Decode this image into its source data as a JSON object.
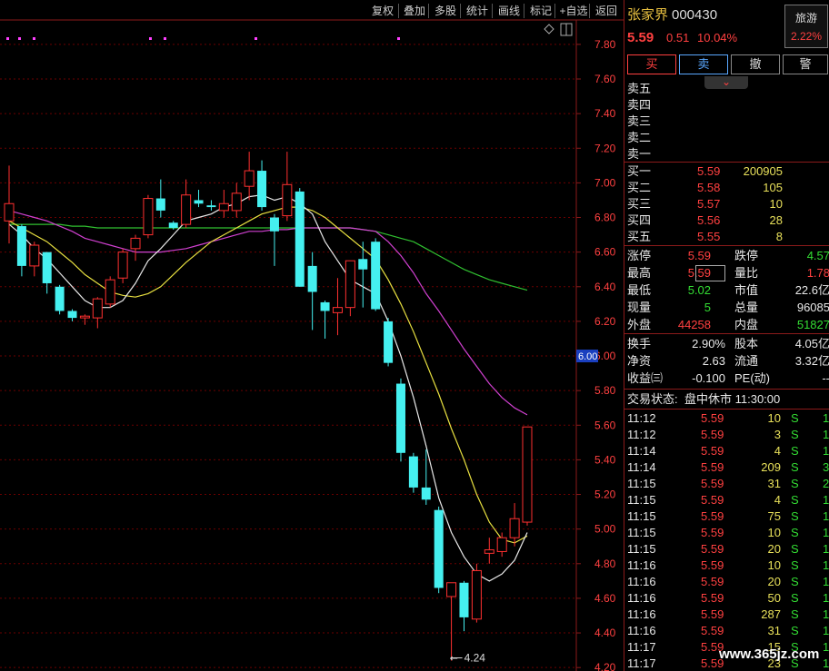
{
  "toolbar": {
    "items": [
      "复权",
      "叠加",
      "多股",
      "统计",
      "画线",
      "标记",
      "+自选",
      "返回"
    ]
  },
  "stock": {
    "name": "张家界",
    "code": "000430",
    "price": "5.59",
    "change": "0.51",
    "change_pct": "10.04%",
    "sector_name": "旅游",
    "sector_pct": "2.22%"
  },
  "actions": {
    "buy": "买",
    "sell": "卖",
    "cancel": "撤",
    "alert": "警"
  },
  "expand_arrow": "⌄",
  "asks": [
    {
      "label": "卖五",
      "price": "",
      "vol": ""
    },
    {
      "label": "卖四",
      "price": "",
      "vol": ""
    },
    {
      "label": "卖三",
      "price": "",
      "vol": ""
    },
    {
      "label": "卖二",
      "price": "",
      "vol": ""
    },
    {
      "label": "卖一",
      "price": "",
      "vol": ""
    }
  ],
  "bids": [
    {
      "label": "买一",
      "price": "5.59",
      "vol": "200905"
    },
    {
      "label": "买二",
      "price": "5.58",
      "vol": "105"
    },
    {
      "label": "买三",
      "price": "5.57",
      "vol": "10"
    },
    {
      "label": "买四",
      "price": "5.56",
      "vol": "28"
    },
    {
      "label": "买五",
      "price": "5.55",
      "vol": "8"
    }
  ],
  "stats": {
    "limit_up_label": "涨停",
    "limit_up": "5.59",
    "limit_down_label": "跌停",
    "limit_down": "4.57",
    "high_label": "最高",
    "high": "5.59",
    "vol_ratio_label": "量比",
    "vol_ratio": "1.78",
    "low_label": "最低",
    "low": "5.02",
    "mkt_cap_label": "市值",
    "mkt_cap": "22.6亿",
    "cur_vol_label": "现量",
    "cur_vol": "5",
    "total_vol_label": "总量",
    "total_vol": "96085",
    "outer_label": "外盘",
    "outer": "44258",
    "inner_label": "内盘",
    "inner": "51827",
    "turnover_label": "换手",
    "turnover": "2.90%",
    "shares_label": "股本",
    "shares": "4.05亿",
    "nav_label": "净资",
    "nav": "2.63",
    "float_label": "流通",
    "float": "3.32亿",
    "eps_label": "收益㈢",
    "eps": "-0.100",
    "pe_label": "PE(动)",
    "pe": "--"
  },
  "status": {
    "label": "交易状态:",
    "value": "盘中休市 11:30:00"
  },
  "trades": [
    {
      "time": "11:12",
      "price": "5.59",
      "vol": "10",
      "side": "S",
      "n": "1"
    },
    {
      "time": "11:12",
      "price": "5.59",
      "vol": "3",
      "side": "S",
      "n": "1"
    },
    {
      "time": "11:14",
      "price": "5.59",
      "vol": "4",
      "side": "S",
      "n": "1"
    },
    {
      "time": "11:14",
      "price": "5.59",
      "vol": "209",
      "side": "S",
      "n": "3"
    },
    {
      "time": "11:15",
      "price": "5.59",
      "vol": "31",
      "side": "S",
      "n": "2"
    },
    {
      "time": "11:15",
      "price": "5.59",
      "vol": "4",
      "side": "S",
      "n": "1"
    },
    {
      "time": "11:15",
      "price": "5.59",
      "vol": "75",
      "side": "S",
      "n": "1"
    },
    {
      "time": "11:15",
      "price": "5.59",
      "vol": "10",
      "side": "S",
      "n": "1"
    },
    {
      "time": "11:15",
      "price": "5.59",
      "vol": "20",
      "side": "S",
      "n": "1"
    },
    {
      "time": "11:16",
      "price": "5.59",
      "vol": "10",
      "side": "S",
      "n": "1"
    },
    {
      "time": "11:16",
      "price": "5.59",
      "vol": "20",
      "side": "S",
      "n": "1"
    },
    {
      "time": "11:16",
      "price": "5.59",
      "vol": "50",
      "side": "S",
      "n": "1"
    },
    {
      "time": "11:16",
      "price": "5.59",
      "vol": "287",
      "side": "S",
      "n": "1"
    },
    {
      "time": "11:16",
      "price": "5.59",
      "vol": "31",
      "side": "S",
      "n": "1"
    },
    {
      "time": "11:17",
      "price": "5.59",
      "vol": "15",
      "side": "S",
      "n": "1"
    },
    {
      "time": "11:17",
      "price": "5.59",
      "vol": "23",
      "side": "S",
      "n": "1"
    }
  ],
  "watermark": "www.365jz.com",
  "chart_data": {
    "type": "candlestick",
    "y_ticks": [
      "7.80",
      "7.60",
      "7.40",
      "7.20",
      "7.00",
      "6.80",
      "6.60",
      "6.40",
      "6.20",
      "6.00",
      "5.80",
      "5.60",
      "5.40",
      "5.20",
      "5.00",
      "4.80",
      "4.60",
      "4.40",
      "4.20"
    ],
    "ylim": [
      4.18,
      7.92
    ],
    "current_price_tag": "6.00",
    "low_marker": "4.24",
    "colors": {
      "up": "#ff3030",
      "down": "#45f0f0",
      "ma5": "#e8e8e8",
      "ma10": "#e8e040",
      "ma20": "#d040d0",
      "ma60": "#30c030",
      "grid": "#6b0000"
    },
    "candles": [
      {
        "o": 6.78,
        "h": 7.1,
        "l": 6.65,
        "c": 6.88
      },
      {
        "o": 6.75,
        "h": 6.76,
        "l": 6.46,
        "c": 6.52
      },
      {
        "o": 6.52,
        "h": 6.66,
        "l": 6.46,
        "c": 6.64
      },
      {
        "o": 6.6,
        "h": 6.6,
        "l": 6.36,
        "c": 6.42
      },
      {
        "o": 6.4,
        "h": 6.41,
        "l": 6.24,
        "c": 6.26
      },
      {
        "o": 6.26,
        "h": 6.27,
        "l": 6.2,
        "c": 6.22
      },
      {
        "o": 6.22,
        "h": 6.24,
        "l": 6.18,
        "c": 6.23
      },
      {
        "o": 6.22,
        "h": 6.34,
        "l": 6.16,
        "c": 6.33
      },
      {
        "o": 6.3,
        "h": 6.46,
        "l": 6.28,
        "c": 6.44
      },
      {
        "o": 6.45,
        "h": 6.62,
        "l": 6.42,
        "c": 6.6
      },
      {
        "o": 6.62,
        "h": 6.7,
        "l": 6.55,
        "c": 6.68
      },
      {
        "o": 6.7,
        "h": 6.93,
        "l": 6.68,
        "c": 6.91
      },
      {
        "o": 6.91,
        "h": 7.02,
        "l": 6.8,
        "c": 6.84
      },
      {
        "o": 6.77,
        "h": 6.78,
        "l": 6.73,
        "c": 6.74
      },
      {
        "o": 6.76,
        "h": 7.02,
        "l": 6.74,
        "c": 6.93
      },
      {
        "o": 6.9,
        "h": 6.96,
        "l": 6.86,
        "c": 6.88
      },
      {
        "o": 6.87,
        "h": 6.9,
        "l": 6.84,
        "c": 6.86
      },
      {
        "o": 6.84,
        "h": 6.96,
        "l": 6.8,
        "c": 6.88
      },
      {
        "o": 6.84,
        "h": 7.0,
        "l": 6.8,
        "c": 6.94
      },
      {
        "o": 6.98,
        "h": 7.18,
        "l": 6.9,
        "c": 7.07
      },
      {
        "o": 7.07,
        "h": 7.13,
        "l": 6.84,
        "c": 6.86
      },
      {
        "o": 6.8,
        "h": 6.82,
        "l": 6.52,
        "c": 6.72
      },
      {
        "o": 6.81,
        "h": 7.18,
        "l": 6.78,
        "c": 6.99
      },
      {
        "o": 6.95,
        "h": 6.97,
        "l": 6.4,
        "c": 6.4
      },
      {
        "o": 6.52,
        "h": 6.6,
        "l": 6.15,
        "c": 6.37
      },
      {
        "o": 6.31,
        "h": 6.32,
        "l": 6.1,
        "c": 6.26
      },
      {
        "o": 6.25,
        "h": 6.45,
        "l": 6.12,
        "c": 6.28
      },
      {
        "o": 6.28,
        "h": 6.55,
        "l": 6.23,
        "c": 6.55
      },
      {
        "o": 6.56,
        "h": 6.66,
        "l": 6.28,
        "c": 6.5
      },
      {
        "o": 6.66,
        "h": 6.68,
        "l": 6.26,
        "c": 6.27
      },
      {
        "o": 6.2,
        "h": 6.22,
        "l": 5.94,
        "c": 5.96
      },
      {
        "o": 5.84,
        "h": 5.87,
        "l": 5.39,
        "c": 5.44
      },
      {
        "o": 5.42,
        "h": 5.44,
        "l": 5.21,
        "c": 5.24
      },
      {
        "o": 5.24,
        "h": 5.46,
        "l": 5.14,
        "c": 5.17
      },
      {
        "o": 5.11,
        "h": 5.13,
        "l": 4.63,
        "c": 4.66
      },
      {
        "o": 4.61,
        "h": 4.68,
        "l": 4.24,
        "c": 4.69
      },
      {
        "o": 4.69,
        "h": 4.7,
        "l": 4.41,
        "c": 4.49
      },
      {
        "o": 4.48,
        "h": 4.8,
        "l": 4.46,
        "c": 4.76
      },
      {
        "o": 4.86,
        "h": 4.95,
        "l": 4.8,
        "c": 4.88
      },
      {
        "o": 4.87,
        "h": 4.98,
        "l": 4.84,
        "c": 4.95
      },
      {
        "o": 4.95,
        "h": 5.15,
        "l": 4.9,
        "c": 5.06
      },
      {
        "o": 5.04,
        "h": 5.59,
        "l": 5.02,
        "c": 5.59
      }
    ],
    "ma5": [
      6.76,
      6.7,
      6.62,
      6.56,
      6.48,
      6.4,
      6.32,
      6.28,
      6.28,
      6.32,
      6.42,
      6.55,
      6.62,
      6.7,
      6.78,
      6.8,
      6.82,
      6.86,
      6.88,
      6.92,
      6.93,
      6.9,
      6.92,
      6.88,
      6.82,
      6.66,
      6.55,
      6.44,
      6.4,
      6.36,
      6.2,
      6.0,
      5.76,
      5.48,
      5.18,
      4.98,
      4.84,
      4.74,
      4.7,
      4.74,
      4.82,
      4.98
    ],
    "ma10": [
      6.78,
      6.74,
      6.7,
      6.66,
      6.6,
      6.54,
      6.47,
      6.42,
      6.37,
      6.35,
      6.34,
      6.36,
      6.4,
      6.47,
      6.54,
      6.6,
      6.66,
      6.7,
      6.74,
      6.78,
      6.82,
      6.84,
      6.86,
      6.86,
      6.84,
      6.8,
      6.74,
      6.68,
      6.62,
      6.56,
      6.44,
      6.3,
      6.14,
      5.96,
      5.78,
      5.58,
      5.4,
      5.2,
      5.04,
      4.94,
      4.92,
      4.96
    ],
    "ma20": [
      6.84,
      6.82,
      6.8,
      6.78,
      6.75,
      6.72,
      6.68,
      6.66,
      6.64,
      6.62,
      6.6,
      6.6,
      6.6,
      6.61,
      6.62,
      6.64,
      6.66,
      6.68,
      6.7,
      6.72,
      6.72,
      6.73,
      6.73,
      6.74,
      6.74,
      6.74,
      6.74,
      6.74,
      6.73,
      6.72,
      6.66,
      6.58,
      6.48,
      6.36,
      6.26,
      6.15,
      6.04,
      5.94,
      5.84,
      5.76,
      5.7,
      5.66
    ],
    "ma60": [
      6.76,
      6.76,
      6.76,
      6.76,
      6.76,
      6.75,
      6.75,
      6.74,
      6.74,
      6.74,
      6.74,
      6.74,
      6.74,
      6.74,
      6.74,
      6.74,
      6.74,
      6.74,
      6.74,
      6.74,
      6.74,
      6.74,
      6.74,
      6.74,
      6.74,
      6.74,
      6.74,
      6.74,
      6.73,
      6.72,
      6.7,
      6.68,
      6.66,
      6.62,
      6.58,
      6.54,
      6.5,
      6.47,
      6.44,
      6.42,
      6.4,
      6.38
    ]
  }
}
